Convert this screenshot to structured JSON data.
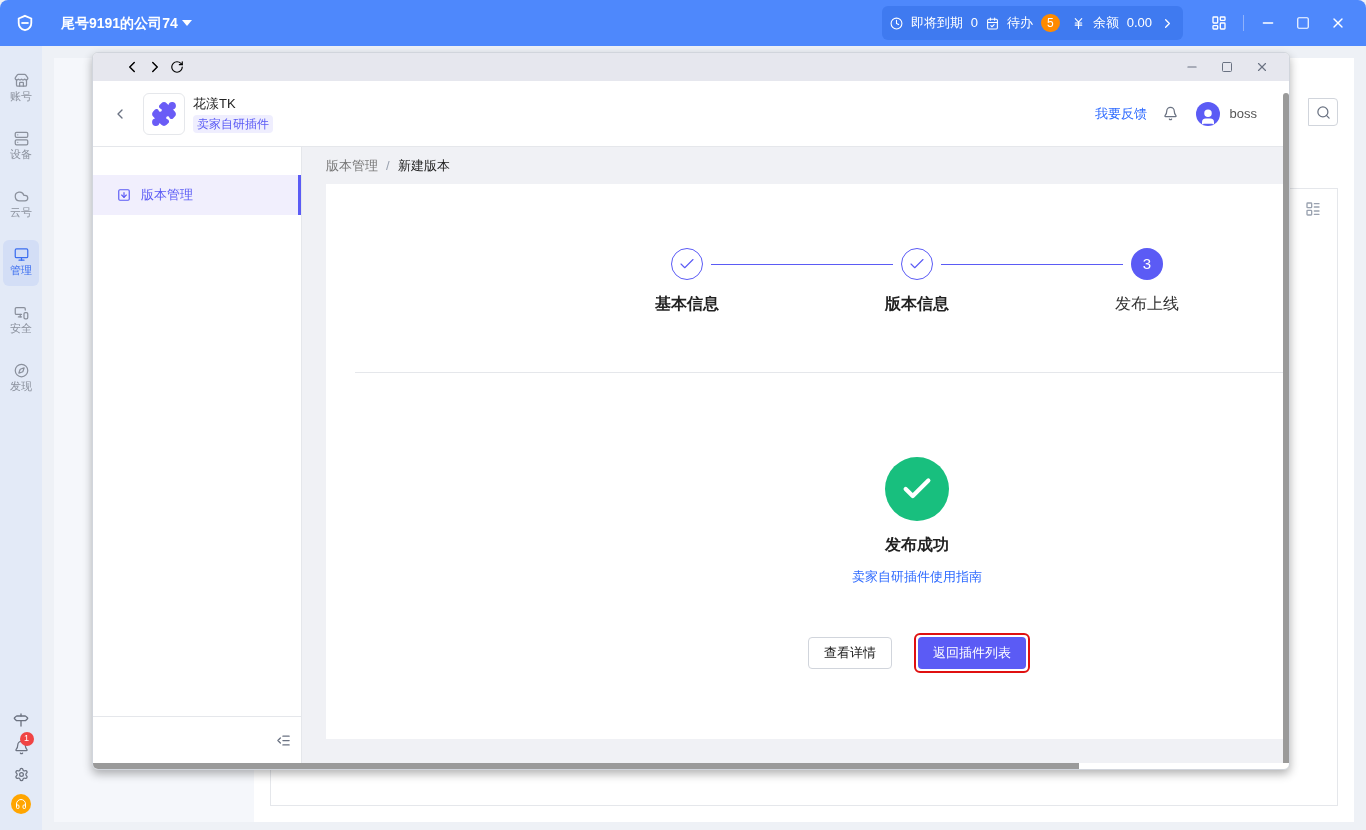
{
  "app": {
    "company": "尾号9191的公司74",
    "expiring_label": "即将到期",
    "expiring_count": "0",
    "todo_label": "待办",
    "todo_count": "5",
    "balance_label": "余额",
    "balance": "0.00"
  },
  "rail": [
    {
      "label": "账号",
      "kind": "store",
      "selected": false
    },
    {
      "label": "设备",
      "kind": "server",
      "selected": false
    },
    {
      "label": "云号",
      "kind": "cloud",
      "selected": false
    },
    {
      "label": "管理",
      "kind": "monitor",
      "selected": true
    },
    {
      "label": "安全",
      "kind": "lock",
      "selected": false
    },
    {
      "label": "发现",
      "kind": "compass",
      "selected": false
    }
  ],
  "rail_notification_count": "1",
  "window": {
    "plugin_name": "花漾TK",
    "plugin_tag": "卖家自研插件",
    "feedback": "我要反馈",
    "user": "boss"
  },
  "sidebar": {
    "items": [
      {
        "label": "版本管理",
        "selected": true
      }
    ]
  },
  "breadcrumb": [
    "版本管理",
    "新建版本"
  ],
  "breadcrumb_separator": "/",
  "steps": [
    {
      "label": "基本信息",
      "completed": true
    },
    {
      "label": "版本信息",
      "completed": true
    },
    {
      "number": "3",
      "label": "发布上线",
      "completed": false
    }
  ],
  "result": {
    "title": "发布成功",
    "link": "卖家自研插件使用指南"
  },
  "buttons": [
    {
      "label": "查看详情",
      "kind": "default",
      "highlighted": false
    },
    {
      "label": "返回插件列表",
      "kind": "primary",
      "highlighted": true
    }
  ]
}
